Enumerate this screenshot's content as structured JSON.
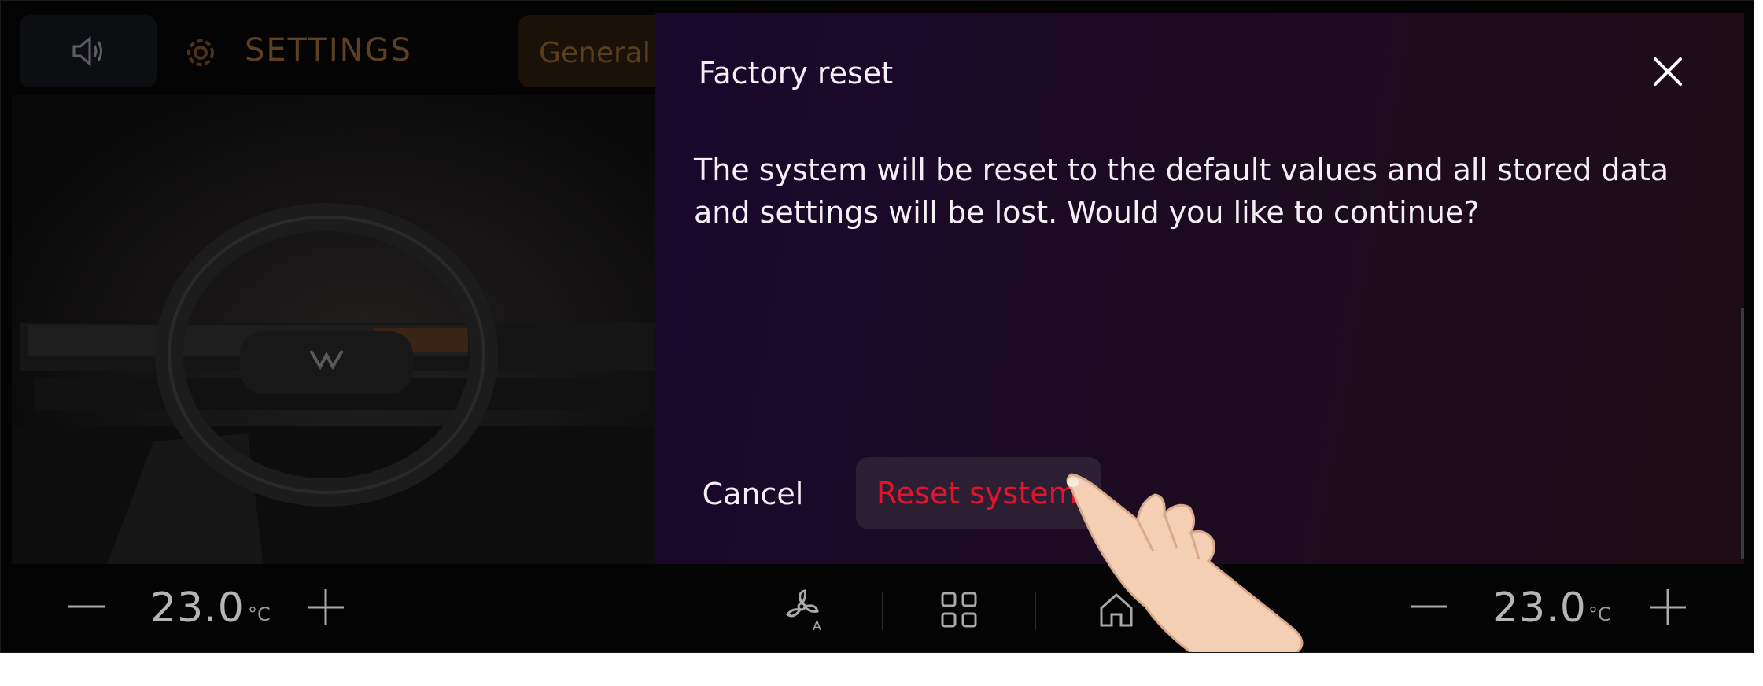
{
  "header": {
    "title": "SETTINGS",
    "volume_icon": "speaker-icon",
    "settings_icon": "gear-icon",
    "tab_general": "General"
  },
  "dialog": {
    "title": "Factory reset",
    "message": "The system will be reset to the default values and all stored data and settings will be lost. Would you like to continue?",
    "close_icon": "close-icon",
    "cancel_label": "Cancel",
    "confirm_label": "Reset system",
    "confirm_color": "#e0142a"
  },
  "climate": {
    "left": {
      "temperature": "23.0",
      "unit": "°C"
    },
    "right": {
      "temperature": "23.0",
      "unit": "°C"
    }
  },
  "dock": {
    "icons": [
      "fan-auto-icon",
      "apps-grid-icon",
      "home-icon"
    ]
  },
  "colors": {
    "accent_orange": "#5e3f1f",
    "dialog_background": "#1c0a24",
    "danger": "#e0142a"
  }
}
